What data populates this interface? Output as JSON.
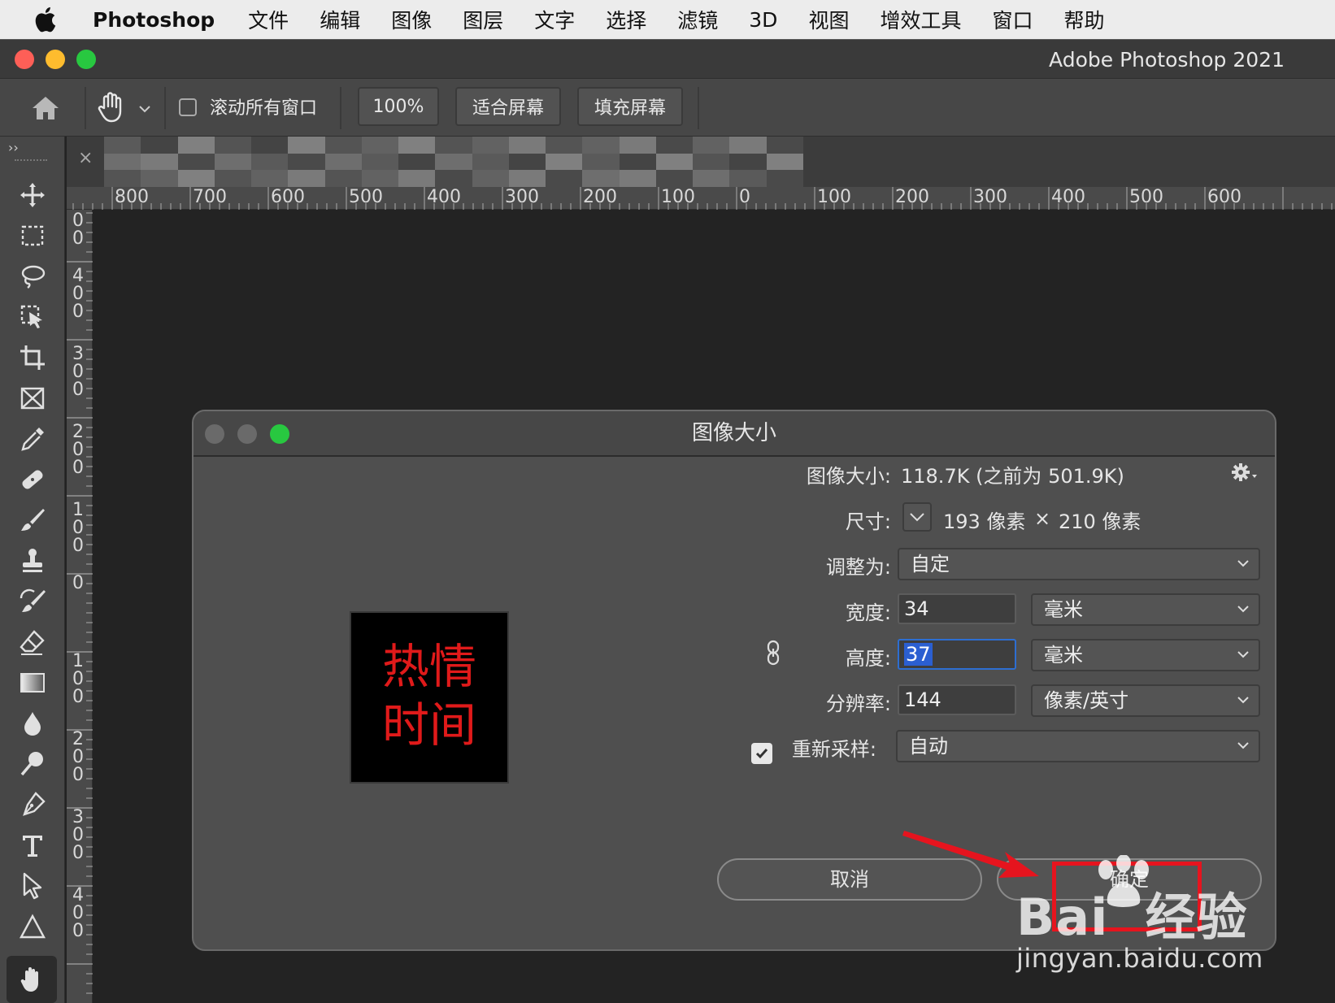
{
  "menubar": {
    "app": "Photoshop",
    "items": [
      "文件",
      "编辑",
      "图像",
      "图层",
      "文字",
      "选择",
      "滤镜",
      "3D",
      "视图",
      "增效工具",
      "窗口",
      "帮助"
    ]
  },
  "window": {
    "title": "Adobe Photoshop 2021"
  },
  "options_bar": {
    "scroll_all_label": "滚动所有窗口",
    "zoom_label": "100%",
    "fit_screen_label": "适合屏幕",
    "fill_screen_label": "填充屏幕"
  },
  "tab": {
    "close": "×"
  },
  "ruler": {
    "h_labels": [
      "800",
      "700",
      "600",
      "500",
      "400",
      "300",
      "200",
      "100",
      "0",
      "100",
      "200",
      "300",
      "400",
      "500",
      "600"
    ],
    "v_labels": [
      "0",
      "0",
      "4",
      "0",
      "0",
      "3",
      "0",
      "0",
      "2",
      "0",
      "0",
      "1",
      "0",
      "0",
      "0",
      "1",
      "0",
      "0",
      "2",
      "0",
      "0",
      "3",
      "0",
      "0",
      "4",
      "0",
      "0"
    ]
  },
  "dialog": {
    "title": "图像大小",
    "image_size_label": "图像大小:",
    "image_size_value": "118.7K (之前为 501.9K)",
    "dimensions_label": "尺寸:",
    "dim_width": "193 像素",
    "dim_times": "×",
    "dim_height": "210 像素",
    "fit_to_label": "调整为:",
    "fit_to_value": "自定",
    "width_label": "宽度:",
    "width_value": "34",
    "width_unit": "毫米",
    "height_label": "高度:",
    "height_value": "37",
    "height_unit": "毫米",
    "resolution_label": "分辨率:",
    "resolution_value": "144",
    "resolution_unit": "像素/英寸",
    "resample_label": "重新采样:",
    "resample_value": "自动",
    "cancel_label": "取消",
    "ok_label": "确定",
    "preview_line1": "热情",
    "preview_line2": "时间"
  },
  "watermark": {
    "brand": "Bai  经验",
    "url": "jingyan.baidu.com"
  },
  "colors": {
    "annotation_red": "#e6141e",
    "preview_text": "#e01a1a",
    "focus_blue": "#2d6ed1",
    "traffic_red": "#fe5f57",
    "traffic_yellow": "#febc2e",
    "traffic_green": "#28c840"
  }
}
